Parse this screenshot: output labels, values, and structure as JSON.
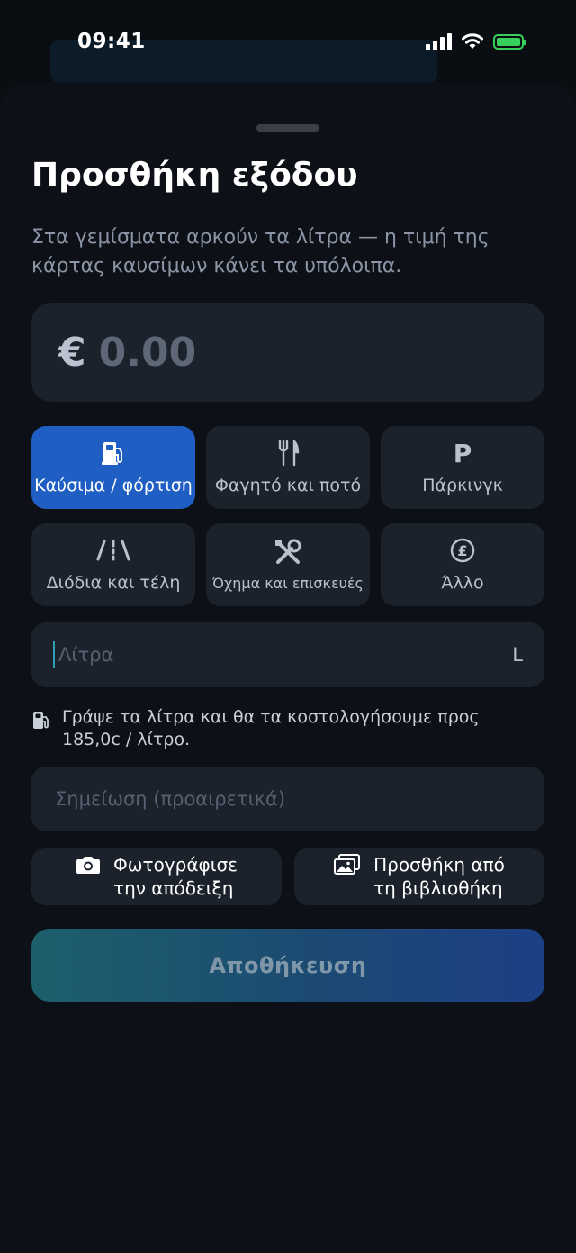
{
  "status_bar": {
    "time": "09:41"
  },
  "sheet": {
    "title": "Προσθήκη εξόδου",
    "subtitle": "Στα γεμίσματα αρκούν τα λίτρα — η τιμή της κάρτας καυσίμων κάνει τα υπόλοιπα."
  },
  "amount": {
    "currency": "€",
    "placeholder": "0.00"
  },
  "categories": [
    {
      "label": "Καύσιμα / φόρτιση",
      "icon": "fuel-pump-icon",
      "selected": true
    },
    {
      "label": "Φαγητό και ποτό",
      "icon": "fork-knife-icon",
      "selected": false
    },
    {
      "label": "Πάρκινγκ",
      "icon": "parking-icon",
      "selected": false
    },
    {
      "label": "Διόδια και τέλη",
      "icon": "road-icon",
      "selected": false
    },
    {
      "label": "Όχημα και επισκευές",
      "icon": "tools-icon",
      "selected": false
    },
    {
      "label": "Άλλο",
      "icon": "pound-coin-icon",
      "selected": false
    }
  ],
  "liters": {
    "placeholder": "Λίτρα",
    "unit": "L",
    "value": ""
  },
  "helper": {
    "icon": "fuel-pump-icon",
    "text": "Γράψε τα λίτρα και θα τα κοστολογήσουμε προς 185,0c / λίτρο."
  },
  "note": {
    "placeholder": "Σημείωση (προαιρετικά)",
    "value": ""
  },
  "buttons": {
    "camera_line1": "Φωτογράφισε",
    "camera_line2": "την απόδειξη",
    "library_line1": "Προσθήκη από",
    "library_line2": "τη βιβλιοθήκη",
    "save": "Αποθήκευση"
  },
  "colors": {
    "accent": "#1f5fc4",
    "background": "#0d1117",
    "card": "#1b222c",
    "battery": "#35d15b"
  }
}
